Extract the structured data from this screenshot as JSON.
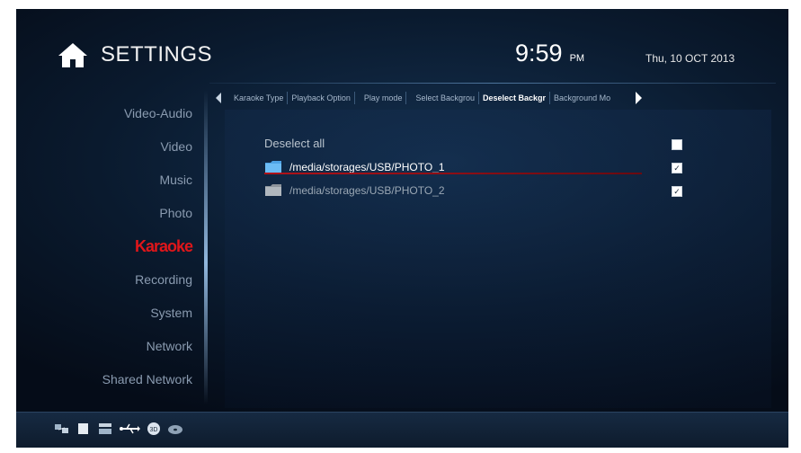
{
  "header": {
    "title": "SETTINGS",
    "time": "9:59",
    "ampm": "PM",
    "date": "Thu, 10 OCT 2013"
  },
  "sidebar": {
    "items": [
      {
        "label": "Video-Audio",
        "active": false
      },
      {
        "label": "Video",
        "active": false
      },
      {
        "label": "Music",
        "active": false
      },
      {
        "label": "Photo",
        "active": false
      },
      {
        "label": "Karaoke",
        "active": true
      },
      {
        "label": "Recording",
        "active": false
      },
      {
        "label": "System",
        "active": false
      },
      {
        "label": "Network",
        "active": false
      },
      {
        "label": "Shared Network",
        "active": false
      }
    ]
  },
  "tabs": [
    {
      "label": "Karaoke Type",
      "active": false
    },
    {
      "label": "Playback Option",
      "active": false
    },
    {
      "label": "Play mode",
      "active": false
    },
    {
      "label": "Select Backgrou",
      "active": false
    },
    {
      "label": "Deselect Backgr",
      "active": true
    },
    {
      "label": "Background Mo",
      "active": false
    }
  ],
  "content": {
    "deselect_all_label": "Deselect all",
    "deselect_all_checked": false,
    "folders": [
      {
        "path": "/media/storages/USB/PHOTO_1",
        "checked": true,
        "selected": true
      },
      {
        "path": "/media/storages/USB/PHOTO_2",
        "checked": true,
        "selected": false
      }
    ]
  },
  "status_icons": [
    "network-icon",
    "storage-icon",
    "card-reader-icon",
    "usb-icon",
    "3d-icon",
    "disc-icon"
  ],
  "colors": {
    "active_sidebar": "#e0161a",
    "selection": "#b01218",
    "background": "#0a1a2e"
  }
}
